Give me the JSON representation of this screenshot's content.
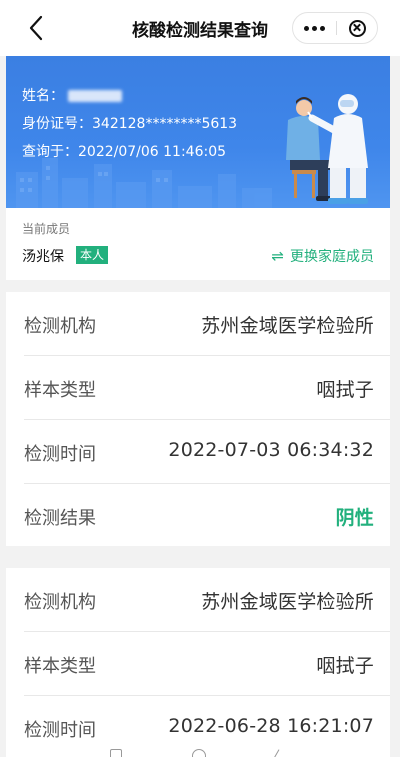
{
  "nav": {
    "title": "核酸检测结果查询"
  },
  "banner": {
    "name_label": "姓名：",
    "id_label": "身份证号：",
    "id_value": "342128********5613",
    "query_label": "查询于：",
    "query_time": "2022/07/06 11:46:05"
  },
  "member": {
    "caption": "当前成员",
    "name": "汤兆保",
    "badge": "本人",
    "switch_label": "更换家庭成员",
    "switch_icon": "⇌"
  },
  "records": [
    {
      "rows": [
        {
          "label": "检测机构",
          "value": "苏州金域医学检验所"
        },
        {
          "label": "样本类型",
          "value": "咽拭子"
        },
        {
          "label": "检测时间",
          "value": "2022-07-03 06:34:32"
        },
        {
          "label": "检测结果",
          "value": "阴性"
        }
      ]
    },
    {
      "rows": [
        {
          "label": "检测机构",
          "value": "苏州金域医学检验所"
        },
        {
          "label": "样本类型",
          "value": "咽拭子"
        },
        {
          "label": "检测时间",
          "value": "2022-06-28 16:21:07"
        }
      ]
    }
  ],
  "colors": {
    "accent_green": "#22b07d",
    "banner_blue": "#3f86ea"
  }
}
